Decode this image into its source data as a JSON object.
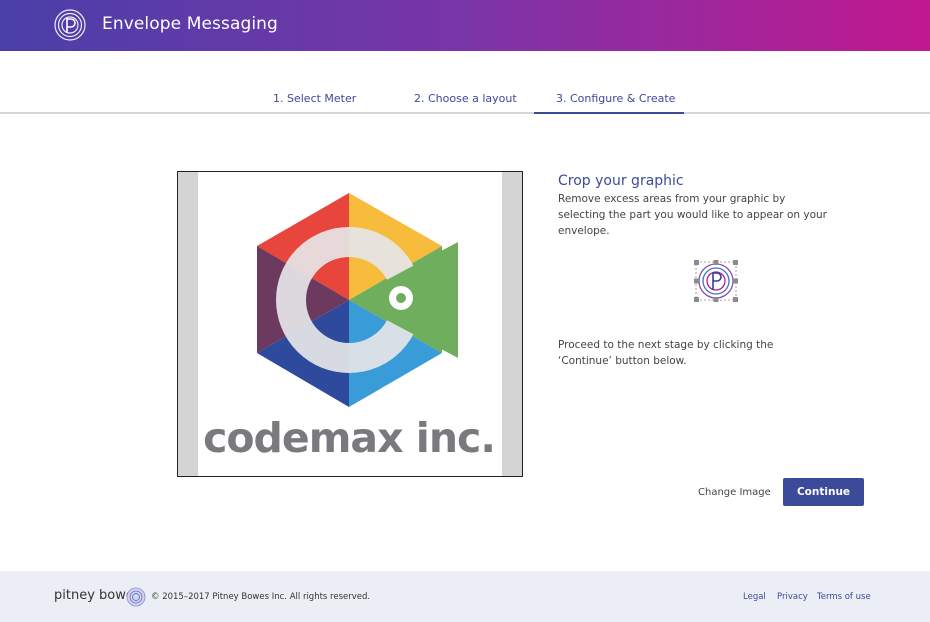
{
  "app": {
    "title": "Envelope Messaging",
    "logo_icon": "pitney-bowes-logo-icon",
    "header_gradient": [
      "#4a3fa8",
      "#c2188f"
    ]
  },
  "steps": [
    {
      "label": "1. Select Meter",
      "active": false
    },
    {
      "label": "2. Choose a layout",
      "active": false
    },
    {
      "label": "3. Configure & Create",
      "active": true
    }
  ],
  "crop": {
    "image_text": "codemax inc.",
    "panel_title": "Crop your graphic",
    "panel_description": "Remove excess areas from your graphic by selecting the part you would like to appear on your envelope.",
    "next_instruction": "Proceed to the next stage by clicking the ‘Continue’ button below."
  },
  "actions": {
    "change_image_label": "Change Image",
    "continue_label": "Continue"
  },
  "footer": {
    "brand": "pitney bowes",
    "copyright": "© 2015–2017 Pitney Bowes Inc. All rights reserved.",
    "links": [
      "Legal",
      "Privacy",
      "Terms of use"
    ]
  },
  "colors": {
    "accent": "#3c4a9a",
    "footer_bg": "#eceef6"
  }
}
